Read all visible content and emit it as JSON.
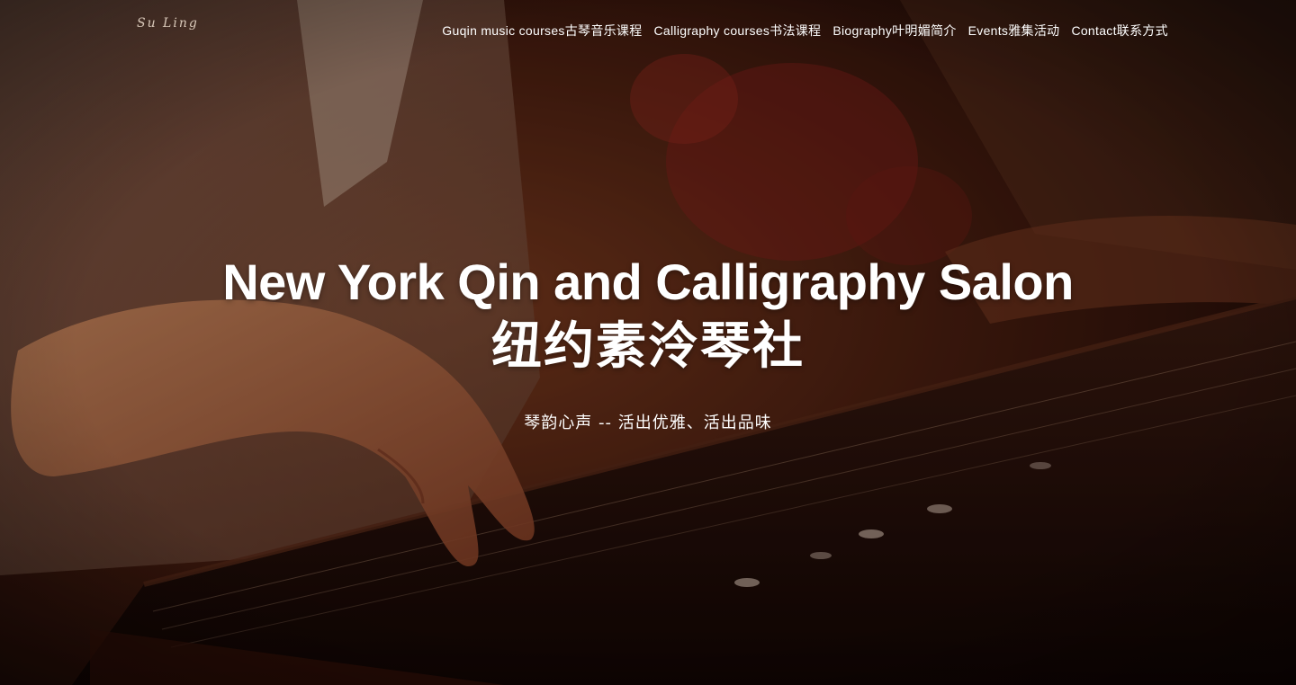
{
  "site": {
    "logo_text": "Su Ling"
  },
  "nav": {
    "items": [
      {
        "label": "Guqin music courses古琴音乐课程"
      },
      {
        "label": "Calligraphy courses书法课程"
      },
      {
        "label": "Biography叶明媚简介"
      },
      {
        "label": "Events雅集活动"
      },
      {
        "label": "Contact联系方式"
      }
    ]
  },
  "hero": {
    "title_en": "New York Qin and Calligraphy Salon",
    "title_zh": "纽约素泠琴社",
    "tagline": "琴韵心声 -- 活出优雅、活出品味",
    "background_description_colors": {
      "dark": "#1a0805",
      "warm": "#7a3a1e",
      "skin": "#c67a4f",
      "accent_red": "#8a1f1a"
    }
  }
}
